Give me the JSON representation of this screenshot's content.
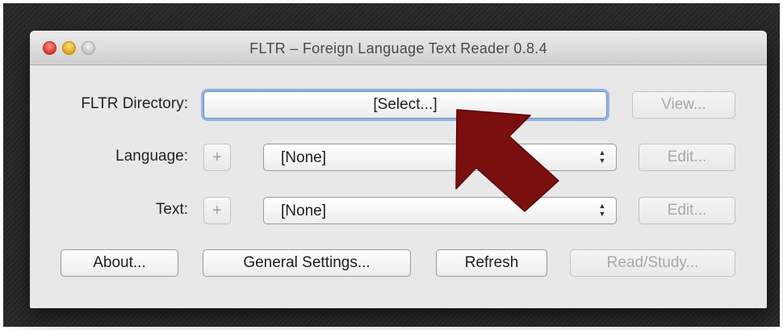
{
  "window": {
    "title": "FLTR – Foreign Language Text Reader 0.8.4"
  },
  "directory": {
    "label": "FLTR Directory:",
    "select_button": "[Select...]",
    "view_button": "View..."
  },
  "language": {
    "label": "Language:",
    "add_button": "+",
    "selected": "[None]",
    "edit_button": "Edit..."
  },
  "text": {
    "label": "Text:",
    "add_button": "+",
    "selected": "[None]",
    "edit_button": "Edit..."
  },
  "actions": {
    "about": "About...",
    "general_settings": "General Settings...",
    "refresh": "Refresh",
    "read_study": "Read/Study..."
  },
  "colors": {
    "annotation_arrow": "#7a0f0f",
    "focus_ring": "#92b4e3"
  },
  "icons": {
    "select_arrows": "up-down-chevron-icon",
    "annotation": "pointer-arrow-icon"
  }
}
